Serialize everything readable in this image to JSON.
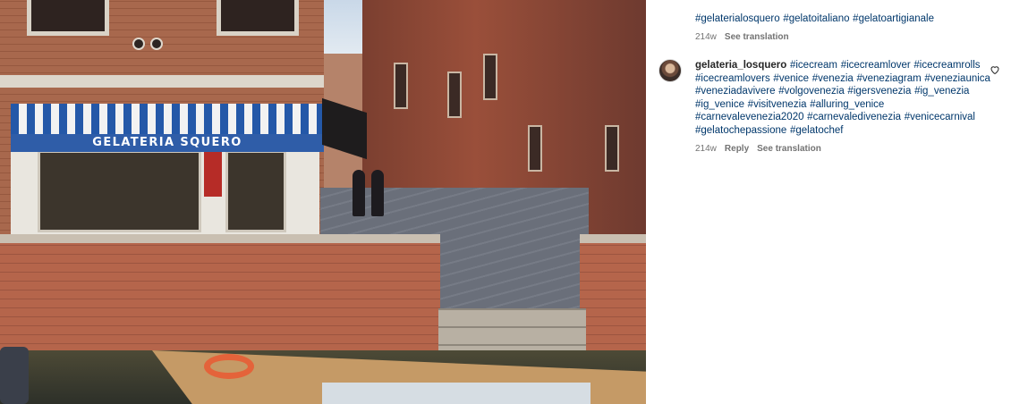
{
  "photo": {
    "awning_text": "GELATERIA SQUERO"
  },
  "comments": {
    "previous": {
      "hashtags": "#gelaterialosquero #gelatoitaliano #gelatoartigianale",
      "time": "214w",
      "see_translation": "See translation"
    },
    "comment": {
      "username": "gelateria_losquero",
      "hashtags": "#icecream #icecreamlover #icecreamrolls #icecreamlovers #venice #venezia #veneziagram #veneziaunica #veneziadavivere #volgovenezia #igersvenezia #ig_venezia #ig_venice #visitvenezia #alluring_venice #carnevalevenezia2020 #carnevaledivenezia #venicecarnival #gelatochepassione #gelatochef",
      "time": "214w",
      "reply": "Reply",
      "see_translation": "See translation"
    }
  },
  "icons": {
    "avatar": "avatar",
    "like": "heart-icon"
  },
  "colors": {
    "hashtag": "#00376b",
    "meta": "#737373",
    "username": "#262626"
  }
}
